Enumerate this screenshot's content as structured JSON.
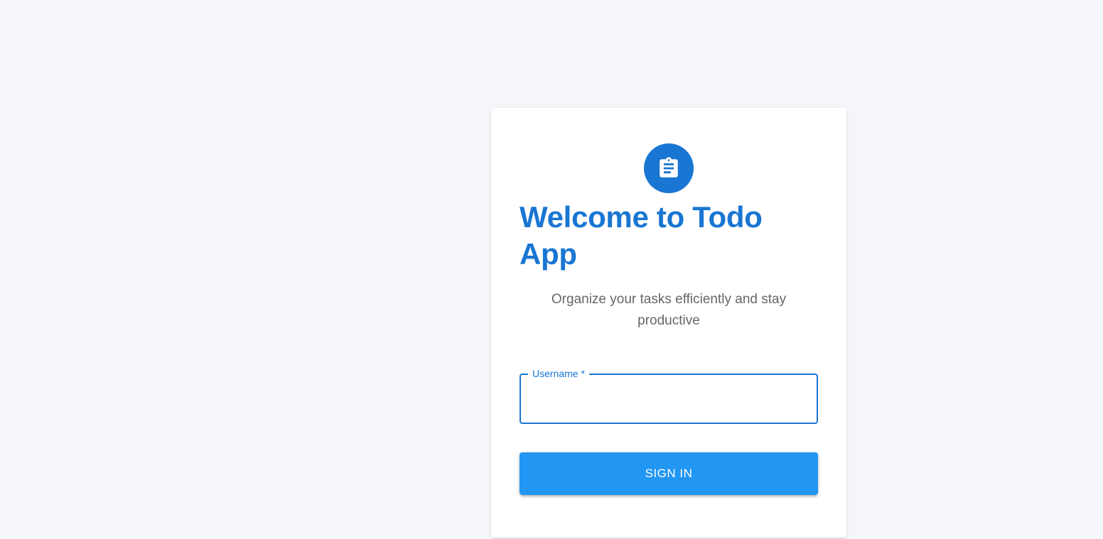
{
  "app": {
    "logo_icon": "clipboard-icon",
    "accent_color": "#1976d2",
    "button_color": "#2196f3"
  },
  "login": {
    "title": "Welcome to Todo App",
    "subtitle": "Organize your tasks efficiently and stay productive",
    "username": {
      "label": "Username *",
      "value": "",
      "placeholder": ""
    },
    "sign_in_label": "SIGN IN"
  }
}
